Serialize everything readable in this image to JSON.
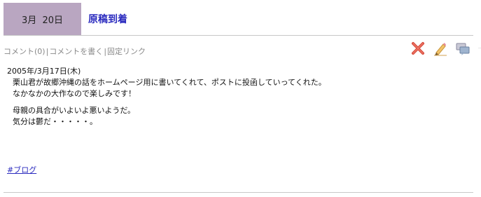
{
  "post": {
    "date_month": "3月",
    "date_day": "20日",
    "title": "原稿到着"
  },
  "toolbar": {
    "comments": "コメント(0)",
    "write_comment": "コメントを書く",
    "permalink": "固定リンク",
    "separator": "|"
  },
  "icons": [
    "delete-icon",
    "edit-icon",
    "comment-icon"
  ],
  "body": {
    "date_line": "2005年/3月17日(木)",
    "p1_line1": "栗山君が故郷沖縄の話をホームページ用に書いてくれて、ポストに投函していってくれた。",
    "p1_line2": "なかなかの大作なので楽しみです！",
    "p2_line1": "母親の具合がいよいよ悪いようだ。",
    "p2_line2": "気分は鬱だ・・・・・。"
  },
  "tag": "#ブログ",
  "colors": {
    "date_bg": "#b9a6c1",
    "title": "#2b2bbf",
    "link": "#2b2bbf",
    "toolbar_text": "#888888"
  }
}
